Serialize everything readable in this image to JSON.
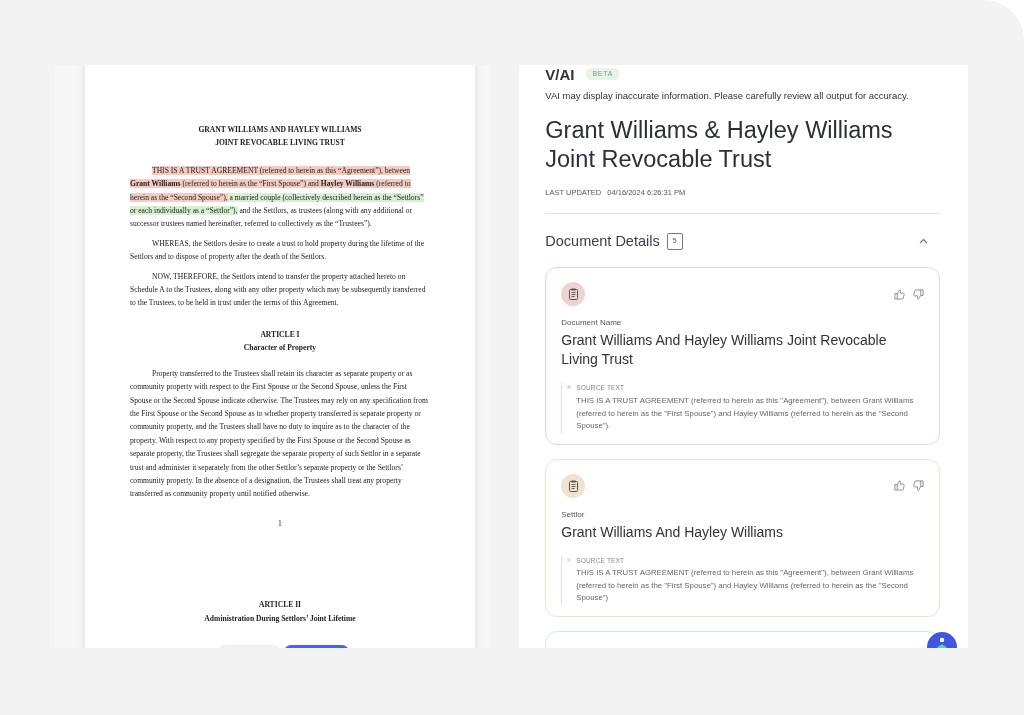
{
  "document": {
    "title_lines": [
      "GRANT WILLIAMS AND HAYLEY WILLIAMS",
      "JOINT REVOCABLE LIVING TRUST"
    ],
    "blocks": [
      {
        "kind": "paragraph",
        "segments": [
          {
            "text": "THIS IS A TRUST AGREEMENT (referred to herein as this “Agreement”), between **Grant Williams** (referred to herein as the “First Spouse”) and **Hayley Williams** (referred to herein as the “Second Spouse”),",
            "color": "#f5cbc1"
          },
          {
            "text": " a married couple (collectively described herein as the “Settlors” or each individually as a “Settlor”),",
            "color": "#d8f0d2"
          },
          {
            "text": " and the Settlors, as trustees (along with any additional or successor trustees named hereinafter, referred to collectively as the “Trustees”)."
          }
        ]
      },
      {
        "kind": "paragraph",
        "segments": [
          {
            "text": "WHEREAS, the Settlors desire to create a trust to hold property during the lifetime of the Settlors and to dispose of property after the death of the Settlors."
          }
        ]
      },
      {
        "kind": "paragraph",
        "segments": [
          {
            "text": "NOW, THEREFORE, the Settlors intend to transfer the property attached hereto on Schedule A to the Trustees, along with any other property which may be subsequently transferred to the Trustees, to be held in trust under the terms of this Agreement."
          }
        ]
      },
      {
        "kind": "heading",
        "lines": [
          "ARTICLE I",
          "Character of Property"
        ]
      },
      {
        "kind": "paragraph",
        "segments": [
          {
            "text": "Property transferred to the Trustees shall retain its character as separate property or as community property with respect to the First Spouse or the Second Spouse, unless the First Spouse or the Second Spouse indicate otherwise.  The Trustees may rely on any specification from the First Spouse or the Second Spouse as to whether property transferred is separate property or community property, and the Trustees shall have no duty to inquire as to the character of the property.  With respect to any property specified by the First Spouse or the Second Spouse as separate property, the Trustees shall segregate the separate property of such Settlor in a separate trust and administer it separately from the other Settlor’s separate property or the Settlors’ community property.  In the absence of a designation, the Trustees shall treat any property transferred as community property until notified otherwise."
          }
        ]
      },
      {
        "kind": "page_number",
        "text": "1"
      },
      {
        "kind": "heading",
        "lines": [
          "ARTICLE II",
          "Administration During Settlors’ Joint Lifetime"
        ]
      }
    ]
  },
  "panel": {
    "logo": "V/AI",
    "badge": "BETA",
    "disclaimer": "VAI may display inaccurate information. Please carefully review all output for accuracy.",
    "title": "Grant Williams & Hayley Williams Joint Revocable Trust",
    "last_updated_label": "LAST UPDATED",
    "last_updated": "04/16/2024 6:26:31 PM",
    "section": {
      "title": "Document Details",
      "count": "5",
      "expanded": true
    },
    "cards": [
      {
        "color": "#efd3d3",
        "label": "Document Name",
        "value": "Grant Williams And Hayley Williams Joint Revocable Living Trust",
        "source_label": "SOURCE TEXT",
        "source": "THIS IS A TRUST AGREEMENT (referred to herein as this \"Agreement\"), between Grant Williams (referred to herein as the \"First Spouse\") and Hayley Williams (referred to herein as the \"Second Spouse\")."
      },
      {
        "color": "#efe3cf",
        "label": "Settlor",
        "value": "Grant Williams And Hayley Williams",
        "source_label": "SOURCE TEXT",
        "source": "THIS IS A TRUST AGREEMENT (referred to herein as this \"Agreement\"), between Grant Williams (referred to herein as the \"First Spouse\") and Hayley Williams (referred to herein as the \"Second Spouse\")"
      },
      {
        "color": "#d3ecd3"
      }
    ]
  }
}
